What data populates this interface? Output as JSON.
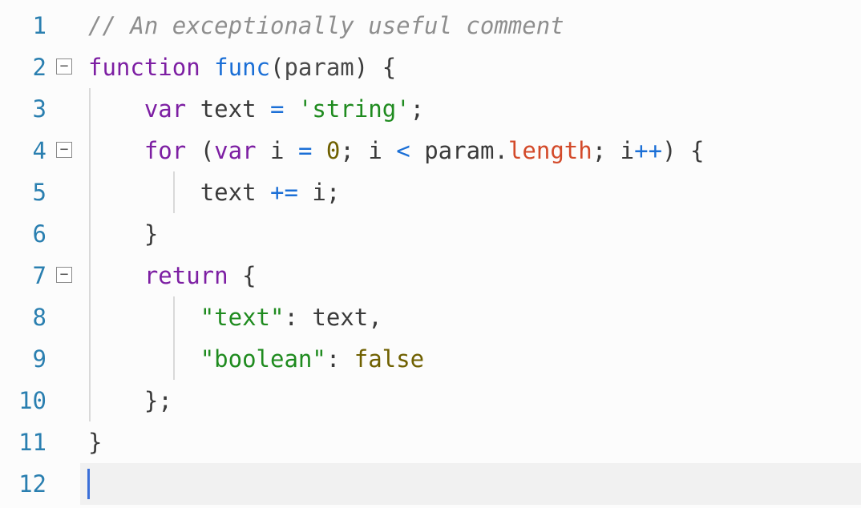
{
  "editor": {
    "lineHeight": 52,
    "cursorLine": 12,
    "lines": [
      {
        "num": "1",
        "fold": null,
        "guides": [],
        "current": false
      },
      {
        "num": "2",
        "fold": "−",
        "guides": [],
        "current": false
      },
      {
        "num": "3",
        "fold": null,
        "guides": [
          "ig1"
        ],
        "current": false
      },
      {
        "num": "4",
        "fold": "−",
        "guides": [
          "ig1"
        ],
        "current": false
      },
      {
        "num": "5",
        "fold": null,
        "guides": [
          "ig1",
          "ig2"
        ],
        "current": false
      },
      {
        "num": "6",
        "fold": null,
        "guides": [
          "ig1"
        ],
        "current": false
      },
      {
        "num": "7",
        "fold": "−",
        "guides": [
          "ig1"
        ],
        "current": false
      },
      {
        "num": "8",
        "fold": null,
        "guides": [
          "ig1",
          "ig2"
        ],
        "current": false
      },
      {
        "num": "9",
        "fold": null,
        "guides": [
          "ig1",
          "ig2"
        ],
        "current": false
      },
      {
        "num": "10",
        "fold": null,
        "guides": [
          "ig1"
        ],
        "current": false
      },
      {
        "num": "11",
        "fold": null,
        "guides": [],
        "current": false
      },
      {
        "num": "12",
        "fold": null,
        "guides": [],
        "current": true
      }
    ]
  },
  "code": {
    "l1": {
      "comment": "// An exceptionally useful comment"
    },
    "l2": {
      "kw": "function",
      "sp1": " ",
      "fn": "func",
      "open": "(",
      "param": "param",
      "close": ")",
      "sp2": " ",
      "brace": "{"
    },
    "l3": {
      "indent": "    ",
      "kw": "var",
      "sp1": " ",
      "id": "text",
      "sp2": " ",
      "eq": "=",
      "sp3": " ",
      "str": "'string'",
      "semi": ";"
    },
    "l4": {
      "indent": "    ",
      "kw": "for",
      "sp1": " ",
      "open": "(",
      "kw2": "var",
      "sp2": " ",
      "id": "i",
      "sp3": " ",
      "eq": "=",
      "sp4": " ",
      "num": "0",
      "semi1": ";",
      "sp5": " ",
      "id2": "i",
      "sp6": " ",
      "lt": "<",
      "sp7": " ",
      "obj": "param",
      "dot": ".",
      "prop": "length",
      "semi2": ";",
      "sp8": " ",
      "id3": "i",
      "inc": "++",
      "close": ")",
      "sp9": " ",
      "brace": "{"
    },
    "l5": {
      "indent": "        ",
      "id": "text",
      "sp1": " ",
      "op": "+=",
      "sp2": " ",
      "id2": "i",
      "semi": ";"
    },
    "l6": {
      "indent": "    ",
      "brace": "}"
    },
    "l7": {
      "indent": "    ",
      "kw": "return",
      "sp1": " ",
      "brace": "{"
    },
    "l8": {
      "indent": "        ",
      "key": "\"text\"",
      "colon": ":",
      "sp1": " ",
      "val": "text",
      "comma": ","
    },
    "l9": {
      "indent": "        ",
      "key": "\"boolean\"",
      "colon": ":",
      "sp1": " ",
      "val": "false"
    },
    "l10": {
      "indent": "    ",
      "brace": "}",
      "semi": ";"
    },
    "l11": {
      "brace": "}"
    }
  }
}
